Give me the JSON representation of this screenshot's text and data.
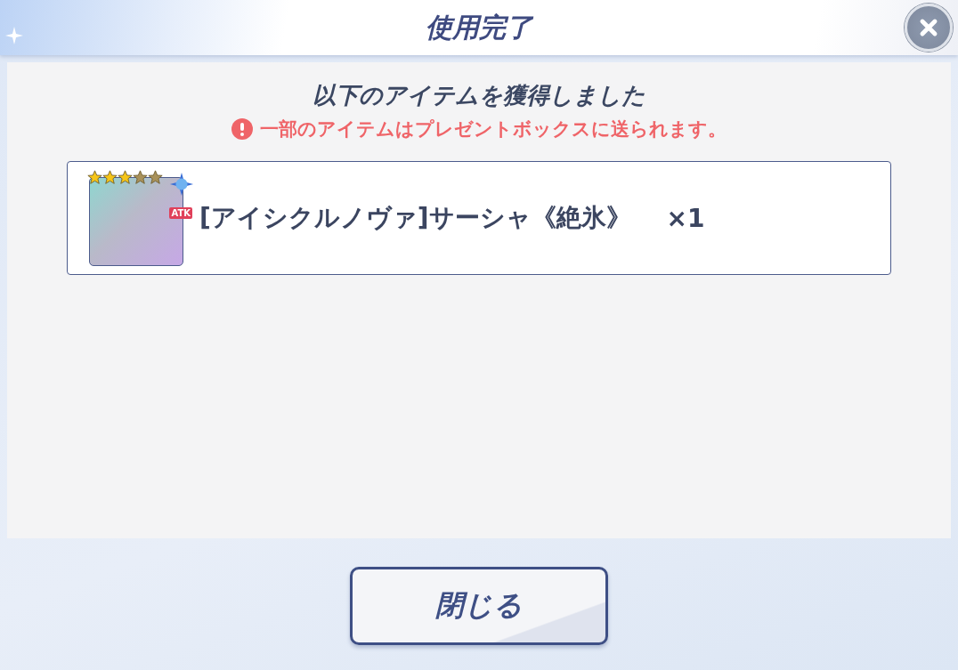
{
  "window": {
    "title": "使用完了"
  },
  "message": {
    "heading": "以下のアイテムを獲得しました",
    "notice": "一部のアイテムはプレゼントボックスに送られます。"
  },
  "items": [
    {
      "name": "[アイシクルノヴァ]サーシャ《絶氷》",
      "quantity": "×1",
      "badge": "ATK",
      "stars": 3
    }
  ],
  "buttons": [
    "閉じる"
  ]
}
